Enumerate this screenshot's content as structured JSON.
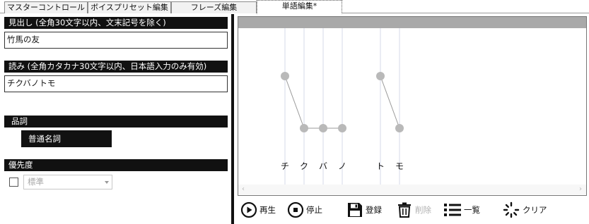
{
  "tabs": [
    {
      "label": "マスターコントロール"
    },
    {
      "label": "ボイスプリセット編集"
    },
    {
      "label": "フレーズ編集"
    },
    {
      "label": "単語編集*"
    }
  ],
  "left": {
    "headword_header": "見出し (全角30文字以内、文末記号を除く)",
    "headword_value": "竹馬の友",
    "reading_header": "読み (全角カタカナ30文字以内、日本語入力のみ有効)",
    "reading_value": "チクバノトモ",
    "pos_header": "品詞",
    "pos_value": "普通名詞",
    "priority_header": "優先度",
    "priority_value": "標準"
  },
  "editor": {
    "morae": [
      "チ",
      "ク",
      "バ",
      "ノ",
      "ト",
      "モ"
    ],
    "accent_high": [
      true,
      false,
      false,
      false,
      true,
      false
    ],
    "groups": [
      [
        0,
        3
      ],
      [
        4,
        5
      ]
    ]
  },
  "toolbar": {
    "play": "再生",
    "stop": "停止",
    "register": "登録",
    "delete": "削除",
    "list": "一覧",
    "clear": "クリア"
  },
  "icons": {
    "play": "play-circle-icon",
    "stop": "stop-circle-icon",
    "register": "floppy-disk-icon",
    "delete": "trash-icon",
    "list": "list-icon",
    "clear": "spinner-clear-icon"
  },
  "colors": {
    "header_bg": "#111111",
    "accent_dot": "#b9b9b9",
    "editor_topbar": "#a9a9a9"
  }
}
